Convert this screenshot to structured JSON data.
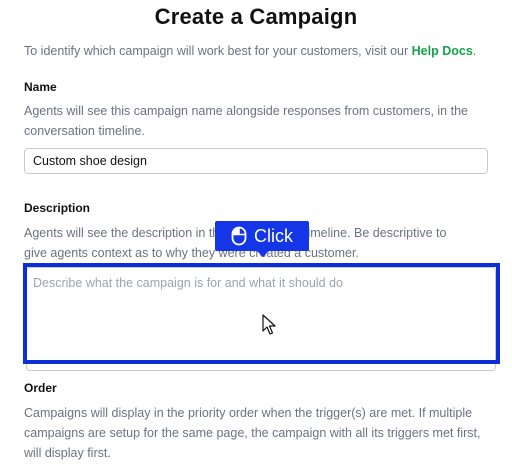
{
  "page": {
    "title": "Create a Campaign",
    "intro_text": "To identify which campaign will work best for your customers, visit our ",
    "help_link": "Help Docs",
    "intro_end": "."
  },
  "name_section": {
    "label": "Name",
    "description": "Agents will see this campaign name alongside responses from customers, in the conversation timeline.",
    "value": "Custom shoe design"
  },
  "description_section": {
    "label": "Description",
    "description_visible_line1": "Agents will see the description in the conversation timeline. Be descriptive to",
    "description_visible_line2": "give agents context as to why they were created a customer.",
    "placeholder": "Describe what the campaign is for and what it should do"
  },
  "order_section": {
    "label": "Order",
    "description": "Campaigns will display in the priority order when the trigger(s) are met. If multiple campaigns are setup for the same page, the campaign with all its triggers met first, will display first."
  },
  "overlay": {
    "click_label": "Click",
    "accent_color": "#1536e6",
    "icons": [
      "mouse-icon",
      "pointer-cursor-icon"
    ]
  },
  "colors": {
    "link": "#16a34a",
    "muted_text": "#6b7280",
    "highlight_border": "#0a2fd6"
  }
}
